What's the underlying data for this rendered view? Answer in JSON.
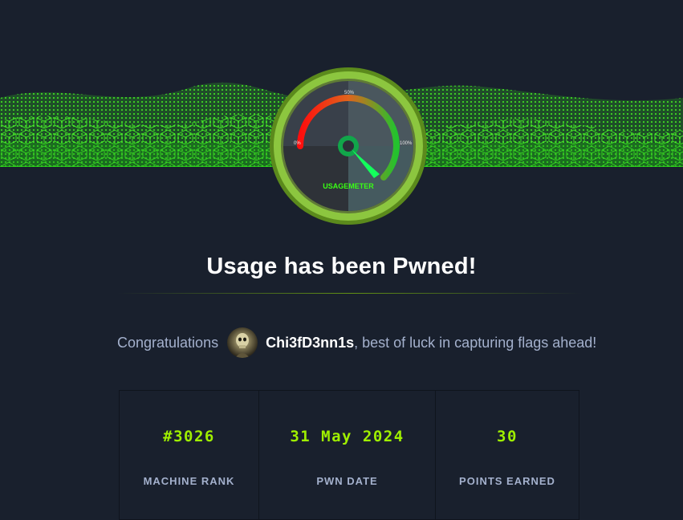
{
  "gauge": {
    "label_0": "0%",
    "label_50": "50%",
    "label_100": "100%",
    "caption": "USAGEMETER"
  },
  "title": "Usage has been Pwned!",
  "congrats": {
    "prefix": "Congratulations",
    "username": "Chi3fD3nn1s",
    "suffix": ", best of luck in capturing flags ahead!"
  },
  "stats": {
    "rank": {
      "value": "#3026",
      "label": "MACHINE RANK"
    },
    "date": {
      "value": "31 May 2024",
      "label": "PWN DATE"
    },
    "points": {
      "value": "30",
      "label": "POINTS EARNED"
    }
  },
  "colors": {
    "background": "#19202d",
    "accent_green": "#9fef00",
    "muted_text": "#a4b1cd"
  }
}
